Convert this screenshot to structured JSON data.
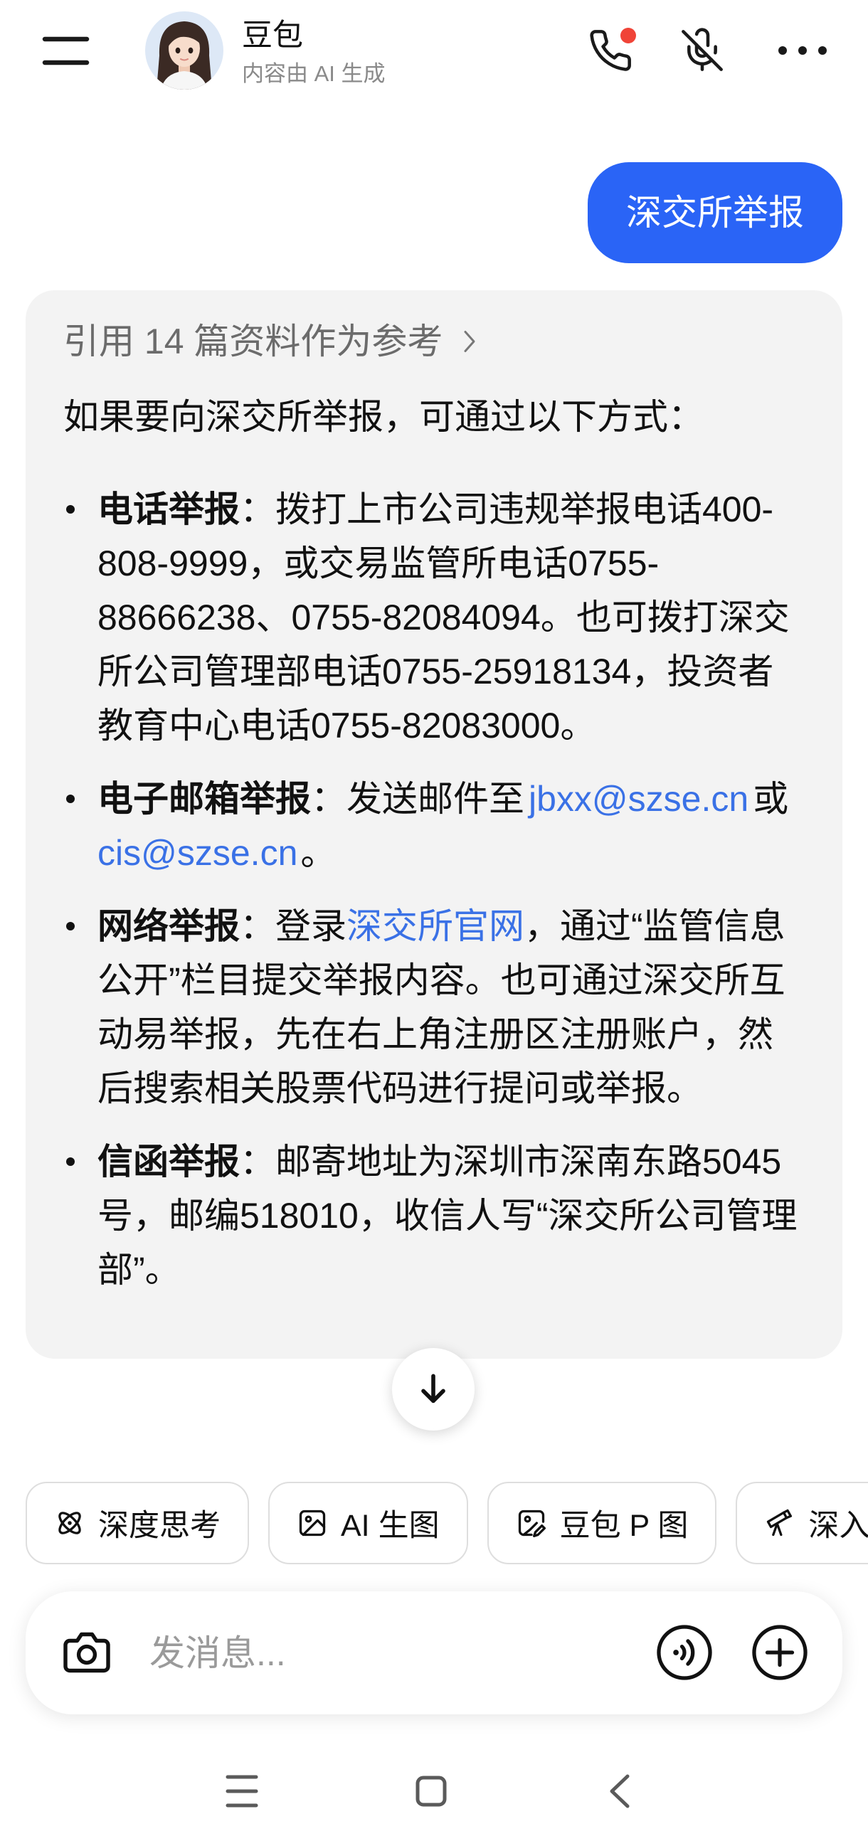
{
  "header": {
    "title": "豆包",
    "subtitle": "内容由 AI 生成",
    "menu_icon": "menu-icon",
    "avatar_icon": "avatar-icon",
    "call_icon": "phone-icon",
    "mute_icon": "mic-off-icon",
    "more_icon": "more-icon"
  },
  "conversation": {
    "user_message": "深交所举报",
    "reply": {
      "references_label": "引用 14 篇资料作为参考",
      "intro": "如果要向深交所举报，可通过以下方式：",
      "items": [
        {
          "label": "电话举报",
          "segments": [
            {
              "text": "：拨打上市公司违规举报电话400-808-9999，或交易监管所电话0755-88666238、0755-82084094。也可拨打深交所公司管理部电话0755-25918134，投资者教育中心电话0755-82083000。"
            }
          ]
        },
        {
          "label": "电子邮箱举报",
          "segments": [
            {
              "text": "：发送邮件至"
            },
            {
              "text": "jbxx@szse.cn",
              "link": true
            },
            {
              "text": "或"
            },
            {
              "text": "cis@szse.cn",
              "link": true
            },
            {
              "text": "。"
            }
          ]
        },
        {
          "label": "网络举报",
          "segments": [
            {
              "text": "：登录"
            },
            {
              "text": "深交所官网",
              "link": true
            },
            {
              "text": "，通过“监管信息公开”栏目提交举报内容。也可通过深交所互动易举报，先在右上角注册区注册账户，然后搜索相关股票代码进行提问或举报。"
            }
          ]
        },
        {
          "label": "信函举报",
          "segments": [
            {
              "text": "：邮寄地址为深圳市深南东路5045号，邮编518010，收信人写“深交所公司管理部”。"
            }
          ]
        }
      ]
    }
  },
  "scroll_down_icon": "arrow-down-icon",
  "quick_actions": [
    {
      "label": "深度思考",
      "icon": "atom-icon"
    },
    {
      "label": "AI 生图",
      "icon": "image-icon"
    },
    {
      "label": "豆包 P 图",
      "icon": "image-edit-icon"
    },
    {
      "label": "深入研究",
      "icon": "telescope-icon"
    }
  ],
  "composer": {
    "placeholder": "发消息...",
    "camera_icon": "camera-icon",
    "voice_icon": "voice-icon",
    "add_icon": "plus-icon"
  },
  "system_nav": {
    "recents_icon": "recents-icon",
    "home_icon": "home-icon",
    "back_icon": "back-icon"
  },
  "colors": {
    "accent": "#2a64f6",
    "link": "#3a71e6",
    "badge": "#f04438",
    "bubble_bg": "#f3f3f3"
  }
}
